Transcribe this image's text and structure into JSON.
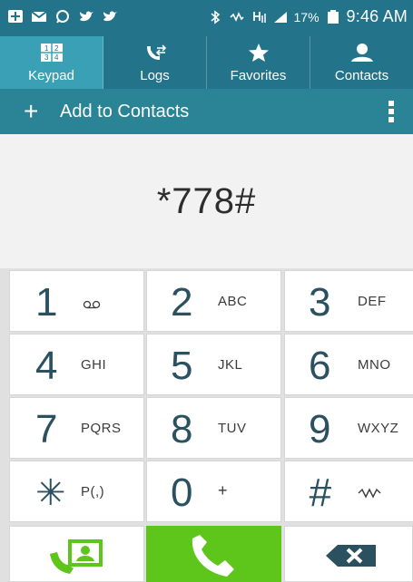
{
  "status_bar": {
    "time": "9:46 AM",
    "battery_percent": "17%",
    "icons": [
      "plus-square-icon",
      "email-icon",
      "whatsapp-icon",
      "twitter-icon",
      "twitter-icon",
      "bluetooth-icon",
      "mute-icon",
      "network-h-icon",
      "signal-icon",
      "battery-icon"
    ]
  },
  "tabs": [
    {
      "label": "Keypad",
      "icon": "keypad-icon",
      "active": true
    },
    {
      "label": "Logs",
      "icon": "logs-icon",
      "active": false
    },
    {
      "label": "Favorites",
      "icon": "star-icon",
      "active": false
    },
    {
      "label": "Contacts",
      "icon": "contact-icon",
      "active": false
    }
  ],
  "action_bar": {
    "add_label": "Add to Contacts",
    "add_icon": "plus-icon",
    "more_icon": "more-vert-icon"
  },
  "display": {
    "number": "*778#"
  },
  "keys": [
    {
      "digit": "1",
      "letters": ""
    },
    {
      "digit": "2",
      "letters": "ABC"
    },
    {
      "digit": "3",
      "letters": "DEF"
    },
    {
      "digit": "4",
      "letters": "GHI"
    },
    {
      "digit": "5",
      "letters": "JKL"
    },
    {
      "digit": "6",
      "letters": "MNO"
    },
    {
      "digit": "7",
      "letters": "PQRS"
    },
    {
      "digit": "8",
      "letters": "TUV"
    },
    {
      "digit": "9",
      "letters": "WXYZ"
    },
    {
      "digit": "✳",
      "letters": "P(,)"
    },
    {
      "digit": "0",
      "letters": "+"
    },
    {
      "digit": "#",
      "letters": ""
    }
  ],
  "bottom_row": {
    "video_call_icon": "video-call-icon",
    "call_icon": "phone-icon",
    "backspace_icon": "backspace-icon"
  },
  "colors": {
    "header": "#23748a",
    "active_tab": "#3aa0b6",
    "action_bar": "#2b8396",
    "call_green": "#5ec51a",
    "digit_color": "#2b5160"
  }
}
